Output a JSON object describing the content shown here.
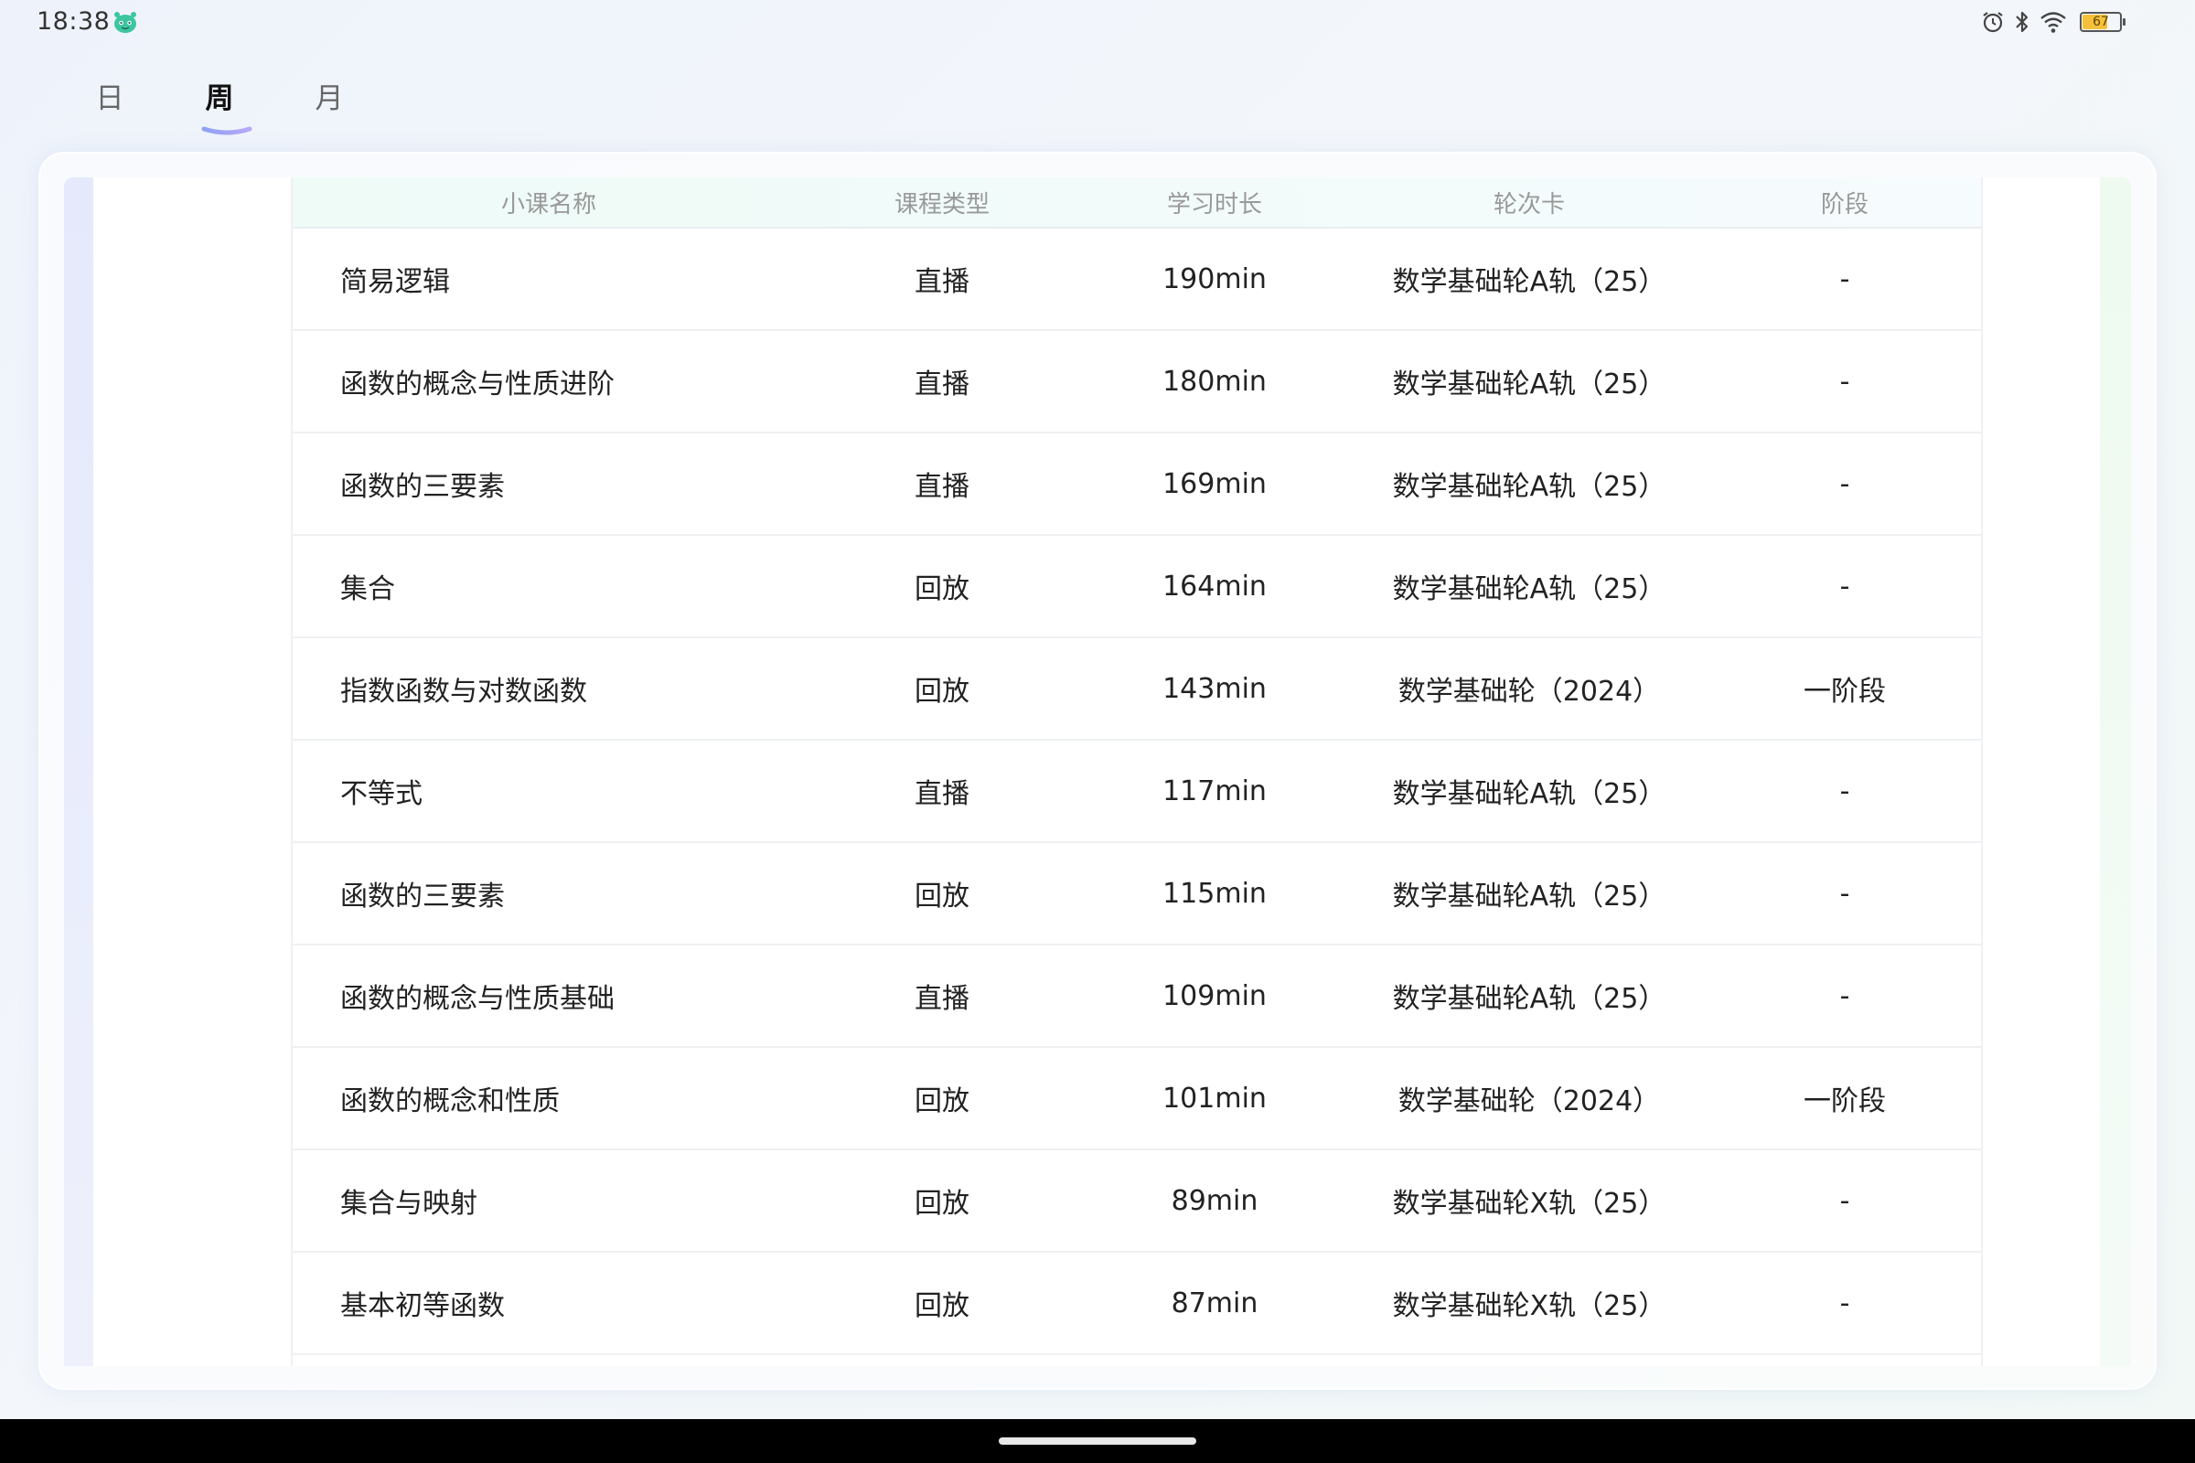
{
  "status_bar": {
    "time": "18:38",
    "battery_level": "67",
    "battery_fill_fraction": 0.67,
    "icons": [
      "app-notification-icon",
      "alarm-icon",
      "bluetooth-icon",
      "wifi-icon",
      "battery-icon"
    ]
  },
  "tabs": [
    {
      "label": "日",
      "active": false
    },
    {
      "label": "周",
      "active": true
    },
    {
      "label": "月",
      "active": false
    }
  ],
  "colors": {
    "tab_underline_start": "#8fa2f5",
    "tab_underline_end": "#b8a8f8",
    "battery": "#f6c03a"
  },
  "table": {
    "headers": {
      "name": "小课名称",
      "type": "课程类型",
      "duration": "学习时长",
      "card": "轮次卡",
      "stage": "阶段"
    },
    "rows": [
      {
        "name": "简易逻辑",
        "type": "直播",
        "duration": "190min",
        "card": "数学基础轮A轨（25）",
        "stage": "-"
      },
      {
        "name": "函数的概念与性质进阶",
        "type": "直播",
        "duration": "180min",
        "card": "数学基础轮A轨（25）",
        "stage": "-"
      },
      {
        "name": "函数的三要素",
        "type": "直播",
        "duration": "169min",
        "card": "数学基础轮A轨（25）",
        "stage": "-"
      },
      {
        "name": "集合",
        "type": "回放",
        "duration": "164min",
        "card": "数学基础轮A轨（25）",
        "stage": "-"
      },
      {
        "name": "指数函数与对数函数",
        "type": "回放",
        "duration": "143min",
        "card": "数学基础轮（2024）",
        "stage": "一阶段"
      },
      {
        "name": "不等式",
        "type": "直播",
        "duration": "117min",
        "card": "数学基础轮A轨（25）",
        "stage": "-"
      },
      {
        "name": "函数的三要素",
        "type": "回放",
        "duration": "115min",
        "card": "数学基础轮A轨（25）",
        "stage": "-"
      },
      {
        "name": "函数的概念与性质基础",
        "type": "直播",
        "duration": "109min",
        "card": "数学基础轮A轨（25）",
        "stage": "-"
      },
      {
        "name": "函数的概念和性质",
        "type": "回放",
        "duration": "101min",
        "card": "数学基础轮（2024）",
        "stage": "一阶段"
      },
      {
        "name": "集合与映射",
        "type": "回放",
        "duration": "89min",
        "card": "数学基础轮X轨（25）",
        "stage": "-"
      },
      {
        "name": "基本初等函数",
        "type": "回放",
        "duration": "87min",
        "card": "数学基础轮X轨（25）",
        "stage": "-"
      }
    ]
  }
}
